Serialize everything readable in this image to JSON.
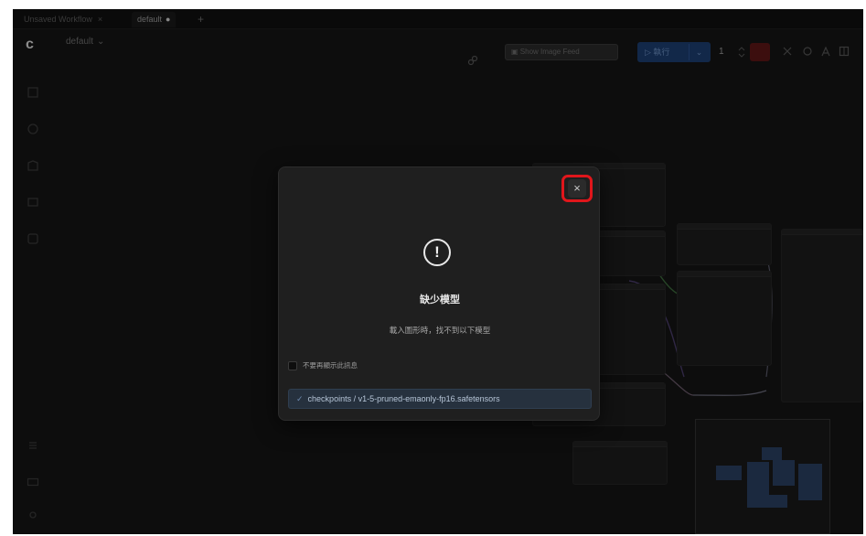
{
  "tabs": [
    {
      "label": "Unsaved Workflow",
      "close": "×"
    },
    {
      "label": "default",
      "indicator": "●"
    }
  ],
  "tab_add": "+",
  "app": {
    "logo": "c",
    "workflow_name": "default",
    "workflow_chevron": "⌄"
  },
  "toolbar": {
    "image_feed_label": "Show Image Feed",
    "run_label": "執行",
    "run_dropdown": "⌄",
    "queue_count": "1"
  },
  "dialog": {
    "close_symbol": "×",
    "icon_glyph": "!",
    "title": "缺少模型",
    "message": "載入圖形時，找不到以下模型",
    "checkbox_label": "不要再顯示此訊息",
    "model_check": "✓",
    "model_path": "checkpoints / v1-5-pruned-emaonly-fp16.safetensors"
  },
  "colors": {
    "highlight": "#e0161b",
    "run_button": "#1d3e70",
    "stop_button": "#5c1616"
  }
}
